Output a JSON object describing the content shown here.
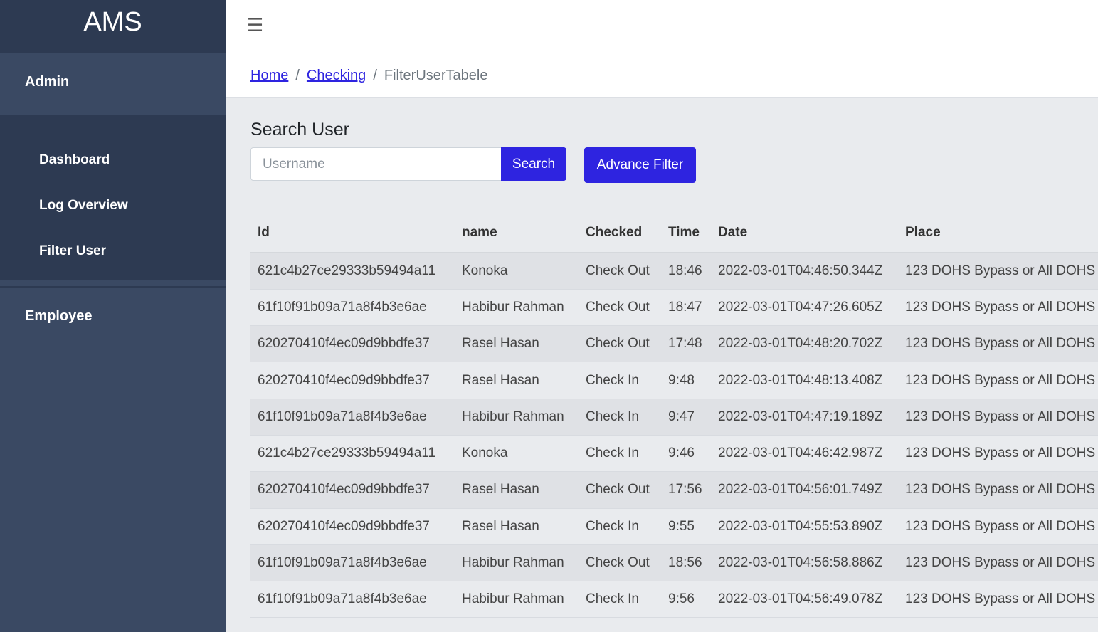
{
  "sidebar": {
    "brand": "AMS",
    "admin_label": "Admin",
    "items": [
      {
        "label": "Dashboard"
      },
      {
        "label": "Log Overview"
      },
      {
        "label": "Filter User"
      }
    ],
    "employee_label": "Employee"
  },
  "topbar": {
    "menu_icon": "hamburger-icon"
  },
  "breadcrumb": {
    "home": "Home",
    "checking": "Checking",
    "current": "FilterUserTabele",
    "separator": "/"
  },
  "search": {
    "title": "Search User",
    "placeholder": "Username",
    "button": "Search",
    "advance_button": "Advance Filter"
  },
  "table": {
    "headers": [
      "Id",
      "name",
      "Checked",
      "Time",
      "Date",
      "Place"
    ],
    "rows": [
      [
        "621c4b27ce29333b59494a11",
        "Konoka",
        "Check Out",
        "18:46",
        "2022-03-01T04:46:50.344Z",
        "123 DOHS Bypass or All DOHS"
      ],
      [
        "61f10f91b09a71a8f4b3e6ae",
        "Habibur Rahman",
        "Check Out",
        "18:47",
        "2022-03-01T04:47:26.605Z",
        "123 DOHS Bypass or All DOHS"
      ],
      [
        "620270410f4ec09d9bbdfe37",
        "Rasel Hasan",
        "Check Out",
        "17:48",
        "2022-03-01T04:48:20.702Z",
        "123 DOHS Bypass or All DOHS"
      ],
      [
        "620270410f4ec09d9bbdfe37",
        "Rasel Hasan",
        "Check In",
        "9:48",
        "2022-03-01T04:48:13.408Z",
        "123 DOHS Bypass or All DOHS"
      ],
      [
        "61f10f91b09a71a8f4b3e6ae",
        "Habibur Rahman",
        "Check In",
        "9:47",
        "2022-03-01T04:47:19.189Z",
        "123 DOHS Bypass or All DOHS"
      ],
      [
        "621c4b27ce29333b59494a11",
        "Konoka",
        "Check In",
        "9:46",
        "2022-03-01T04:46:42.987Z",
        "123 DOHS Bypass or All DOHS"
      ],
      [
        "620270410f4ec09d9bbdfe37",
        "Rasel Hasan",
        "Check Out",
        "17:56",
        "2022-03-01T04:56:01.749Z",
        "123 DOHS Bypass or All DOHS"
      ],
      [
        "620270410f4ec09d9bbdfe37",
        "Rasel Hasan",
        "Check In",
        "9:55",
        "2022-03-01T04:55:53.890Z",
        "123 DOHS Bypass or All DOHS"
      ],
      [
        "61f10f91b09a71a8f4b3e6ae",
        "Habibur Rahman",
        "Check Out",
        "18:56",
        "2022-03-01T04:56:58.886Z",
        "123 DOHS Bypass or All DOHS"
      ],
      [
        "61f10f91b09a71a8f4b3e6ae",
        "Habibur Rahman",
        "Check In",
        "9:56",
        "2022-03-01T04:56:49.078Z",
        "123 DOHS Bypass or All DOHS"
      ]
    ]
  },
  "colors": {
    "sidebar": "#3a4963",
    "sidebar_dark": "#2d3a52",
    "accent": "#2e24e0"
  }
}
